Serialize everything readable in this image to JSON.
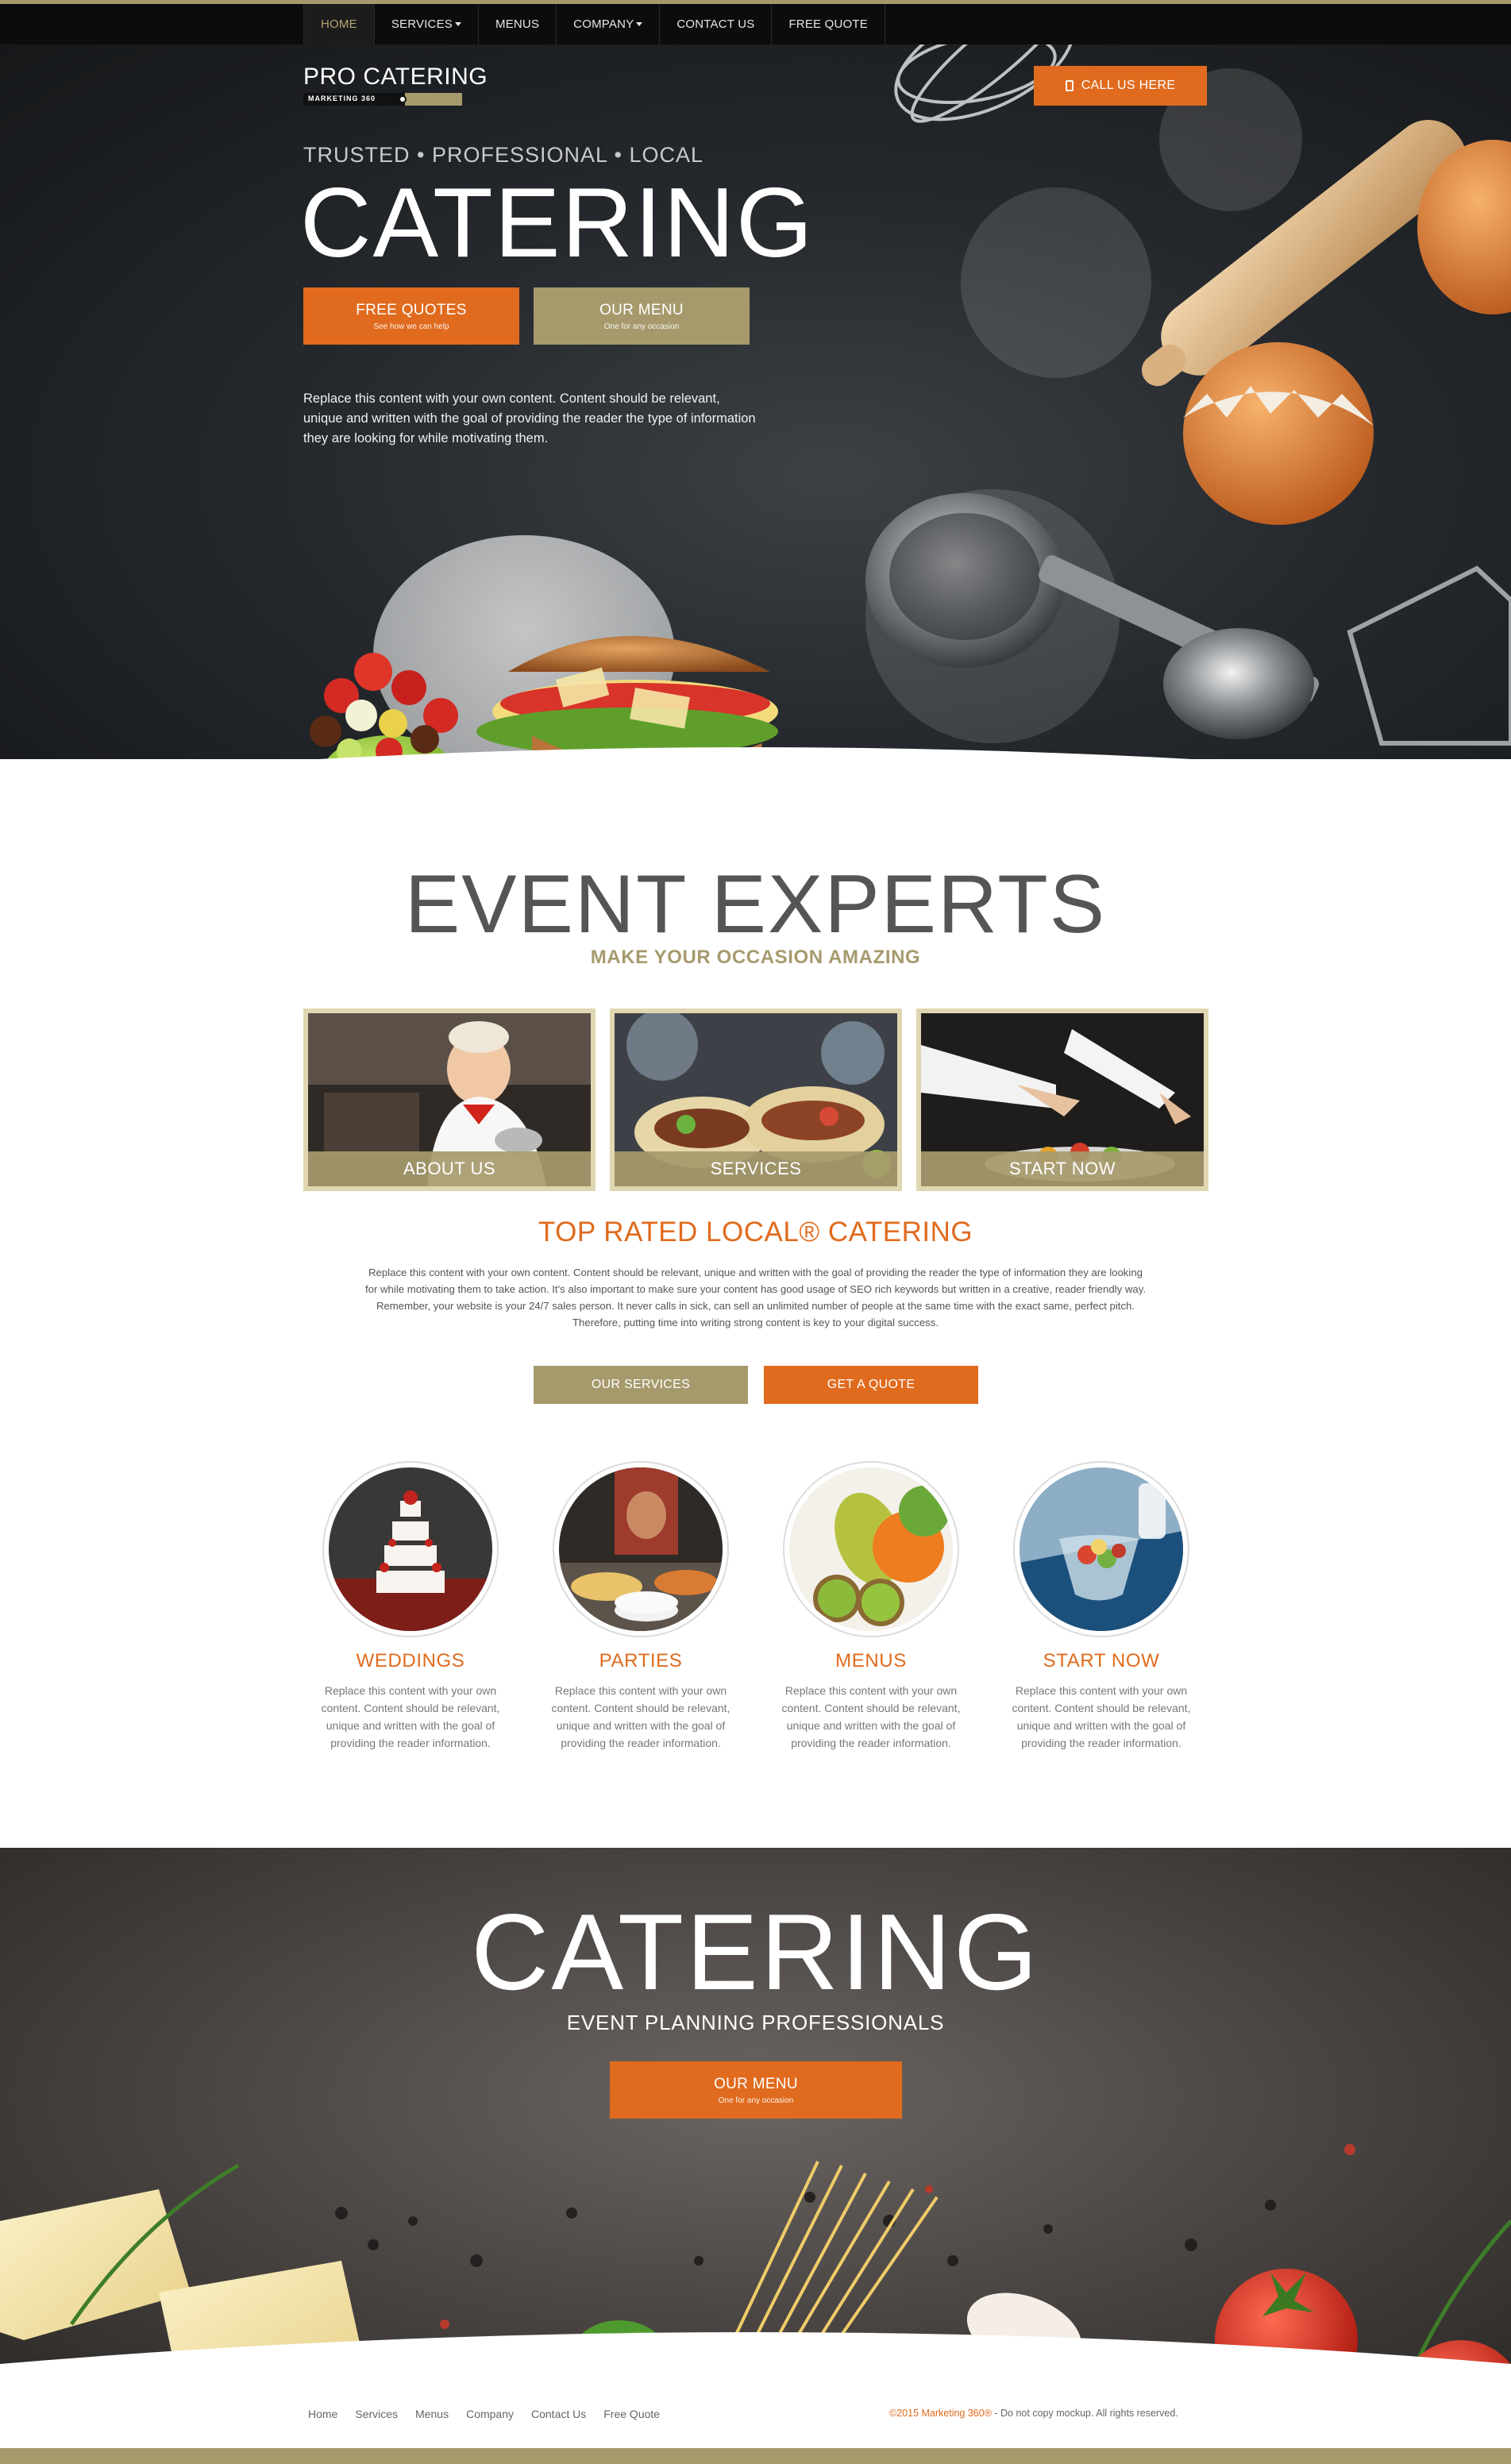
{
  "nav": {
    "items": [
      {
        "label": "HOME",
        "active": true,
        "dropdown": false
      },
      {
        "label": "SERVICES",
        "active": false,
        "dropdown": true
      },
      {
        "label": "MENUS",
        "active": false,
        "dropdown": false
      },
      {
        "label": "COMPANY",
        "active": false,
        "dropdown": true
      },
      {
        "label": "CONTACT US",
        "active": false,
        "dropdown": false
      },
      {
        "label": "FREE QUOTE",
        "active": false,
        "dropdown": false
      }
    ]
  },
  "logo": {
    "title": "PRO CATERING",
    "badge": "MARKETING 360"
  },
  "call_button": {
    "label": "CALL US HERE",
    "icon": "phone-icon"
  },
  "hero": {
    "tagline": "TRUSTED • PROFESSIONAL • LOCAL",
    "title": "CATERING",
    "free_quotes": {
      "label": "FREE QUOTES",
      "sub": "See how we can help"
    },
    "our_menu": {
      "label": "OUR MENU",
      "sub": "One for any occasion"
    },
    "description": "Replace this content with your own content. Content should be relevant, unique and written with the goal of providing the reader the type of information they are looking for while motivating them."
  },
  "event_experts": {
    "title": "EVENT EXPERTS",
    "subtitle": "MAKE YOUR OCCASION AMAZING",
    "cards": [
      {
        "label": "ABOUT US"
      },
      {
        "label": "SERVICES"
      },
      {
        "label": "START NOW"
      }
    ]
  },
  "top_rated": {
    "title": "TOP RATED LOCAL® CATERING",
    "text": "Replace this content with your own content. Content should be relevant, unique and written with the goal of providing the reader the type of information they are looking for while motivating them to take action. It's also important to make sure your content has good usage of SEO rich keywords but written in a creative, reader friendly way. Remember, your website is your 24/7 sales person. It never calls in sick, can sell an unlimited number of people at the same time with the exact same, perfect pitch. Therefore, putting time into writing strong content is key to your digital success.",
    "our_services": "OUR SERVICES",
    "get_quote": "GET A QUOTE"
  },
  "features": [
    {
      "title": "WEDDINGS",
      "text": "Replace this content with your own content. Content should be relevant, unique and written with the goal of providing the reader information."
    },
    {
      "title": "PARTIES",
      "text": "Replace this content with your own content. Content should be relevant, unique and written with the goal of providing the reader information."
    },
    {
      "title": "MENUS",
      "text": "Replace this content with your own content. Content should be relevant, unique and written with the goal of providing the reader information."
    },
    {
      "title": "START NOW",
      "text": "Replace this content with your own content. Content should be relevant, unique and written with the goal of providing the reader information."
    }
  ],
  "hero2": {
    "title": "CATERING",
    "subtitle": "EVENT PLANNING PROFESSIONALS",
    "button": {
      "label": "OUR MENU",
      "sub": "One for any occasion"
    }
  },
  "footer": {
    "links": [
      "Home",
      "Services",
      "Menus",
      "Company",
      "Contact Us",
      "Free Quote"
    ],
    "copyright_brand": "©2015 Marketing 360®",
    "copyright_rest": " - Do not copy mockup. All rights reserved."
  },
  "colors": {
    "orange": "#e06b1e",
    "khaki": "#a69a6d",
    "dark": "#0c0c0c"
  }
}
